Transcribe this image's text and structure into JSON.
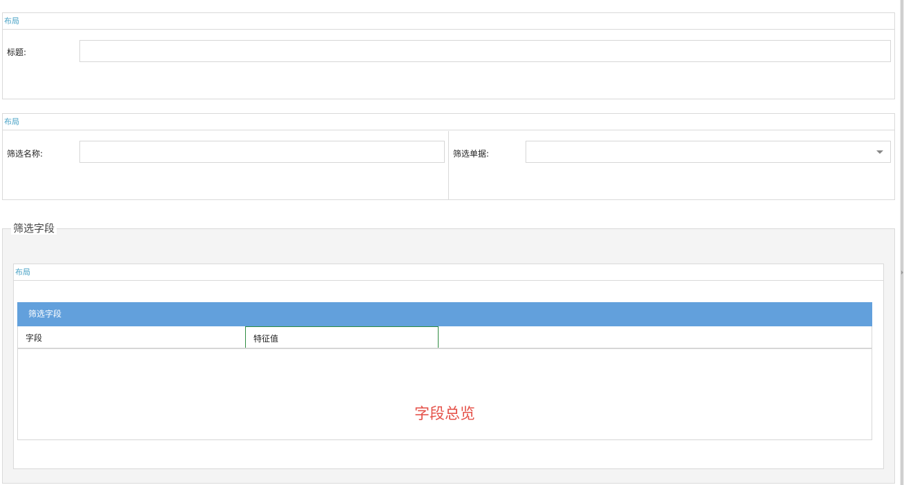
{
  "section_title": {
    "layout_label": "布局",
    "title_label": "标题:",
    "title_value": ""
  },
  "section_filter": {
    "layout_label": "布局",
    "filter_name_label": "筛选名称:",
    "filter_name_value": "",
    "filter_doc_label": "筛选单据:",
    "filter_doc_value": ""
  },
  "fields_group": {
    "legend": "筛选字段",
    "layout_label": "布局",
    "grid": {
      "header": "筛选字段",
      "columns": [
        "字段",
        "特征值"
      ],
      "empty_text": "字段总览"
    }
  },
  "icons": {
    "dropdown": "chevron-down-icon"
  }
}
